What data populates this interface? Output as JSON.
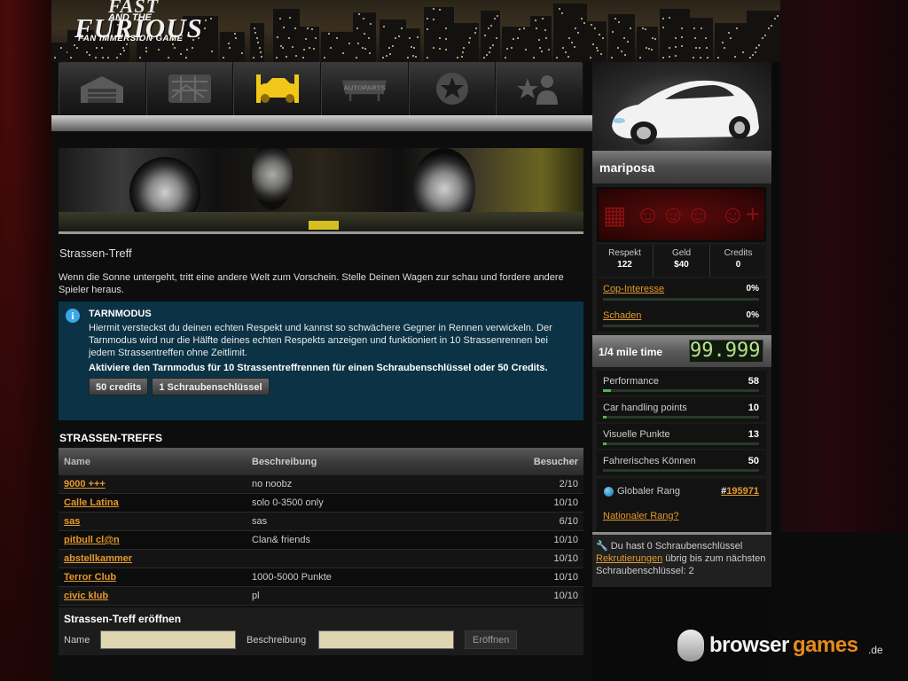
{
  "logo": {
    "line1": "FAST",
    "line2": "AND THE",
    "line3": "FURIOUS",
    "line4": "FAN IMMERSION GAME"
  },
  "nav": [
    {
      "name": "garage",
      "icon": "garage-icon"
    },
    {
      "name": "map",
      "icon": "map-icon"
    },
    {
      "name": "cars",
      "icon": "car-icon",
      "active": true
    },
    {
      "name": "autoparts",
      "icon": "autoparts-icon",
      "label": "AUTOPARTS"
    },
    {
      "name": "star",
      "icon": "star-icon"
    },
    {
      "name": "profile",
      "icon": "user-star-icon"
    }
  ],
  "page": {
    "title": "Strassen-Treff",
    "intro": "Wenn die Sonne untergeht, tritt eine andere Welt zum Vorschein. Stelle Deinen Wagen zur schau und fordere andere Spieler heraus."
  },
  "info": {
    "icon": "info-icon",
    "heading": "TARNMODUS",
    "text": "Hiermit versteckst du deinen echten Respekt und kannst so schwächere Gegner in Rennen verwickeln. Der Tarnmodus wird nur die Hälfte deines echten Respekts anzeigen und funktioniert in 10 Strassenrennen bei jedem Strassentreffen ohne Zeitlimit.",
    "bold_text": "Aktiviere den Tarnmodus für 10 Strassentreffrennen für einen Schraubenschlüssel oder 50 Credits.",
    "btn_credits": "50 credits",
    "btn_key": "1 Schraubenschlüssel"
  },
  "list": {
    "title": "STRASSEN-TREFFS",
    "headers": {
      "name": "Name",
      "desc": "Beschreibung",
      "visitors": "Besucher"
    },
    "rows": [
      {
        "name": "9000 +++",
        "desc": "no noobz",
        "visitors": "2/10"
      },
      {
        "name": "Calle Latina",
        "desc": "solo 0-3500 only",
        "visitors": "10/10"
      },
      {
        "name": "sas",
        "desc": "sas",
        "visitors": "6/10"
      },
      {
        "name": "pitbull cl@n",
        "desc": "Clan& friends",
        "visitors": "10/10"
      },
      {
        "name": "abstellkammer",
        "desc": "",
        "visitors": "10/10"
      },
      {
        "name": "Terror Club",
        "desc": "1000-5000 Punkte",
        "visitors": "10/10"
      },
      {
        "name": "civic klub",
        "desc": "pl",
        "visitors": "10/10"
      }
    ]
  },
  "create": {
    "title": "Strassen-Treff eröffnen",
    "name_label": "Name",
    "name_value": "",
    "desc_label": "Beschreibung",
    "desc_value": "",
    "button": "Eröffnen"
  },
  "sidebar": {
    "player": "mariposa",
    "stats": [
      {
        "label": "Respekt",
        "value": "122"
      },
      {
        "label": "Geld",
        "value": "$40"
      },
      {
        "label": "Credits",
        "value": "0"
      }
    ],
    "cop": {
      "label": "Cop-Interesse",
      "value": "0%",
      "level": 0
    },
    "damage": {
      "label": "Schaden",
      "value": "0%",
      "level": 0
    },
    "mile": {
      "label": "1/4 mile time",
      "value": "99.999"
    },
    "car_stats": [
      {
        "label": "Performance",
        "value": "58",
        "level": 0.05
      },
      {
        "label": "Car handling points",
        "value": "10",
        "level": 0.02
      },
      {
        "label": "Visuelle Punkte",
        "value": "13",
        "level": 0.02
      },
      {
        "label": "Fahrerisches Können",
        "value": "50",
        "level": 0
      }
    ],
    "rank": {
      "label": "Globaler Rang",
      "hash": "#",
      "value": "195971",
      "national": "Nationaler Rang?"
    },
    "keys": {
      "pre": "Du hast 0 Schraubenschlüssel",
      "link": "Rekrutierungen",
      "post": "übrig bis zum nächsten Schraubenschlüssel: 2"
    }
  },
  "watermark": {
    "t1": "browser",
    "t2": "games",
    "t3": ".de"
  },
  "colors": {
    "accent": "#e59a2a",
    "info_bg": "#0b3345",
    "active_nav": "#f3c71a"
  }
}
